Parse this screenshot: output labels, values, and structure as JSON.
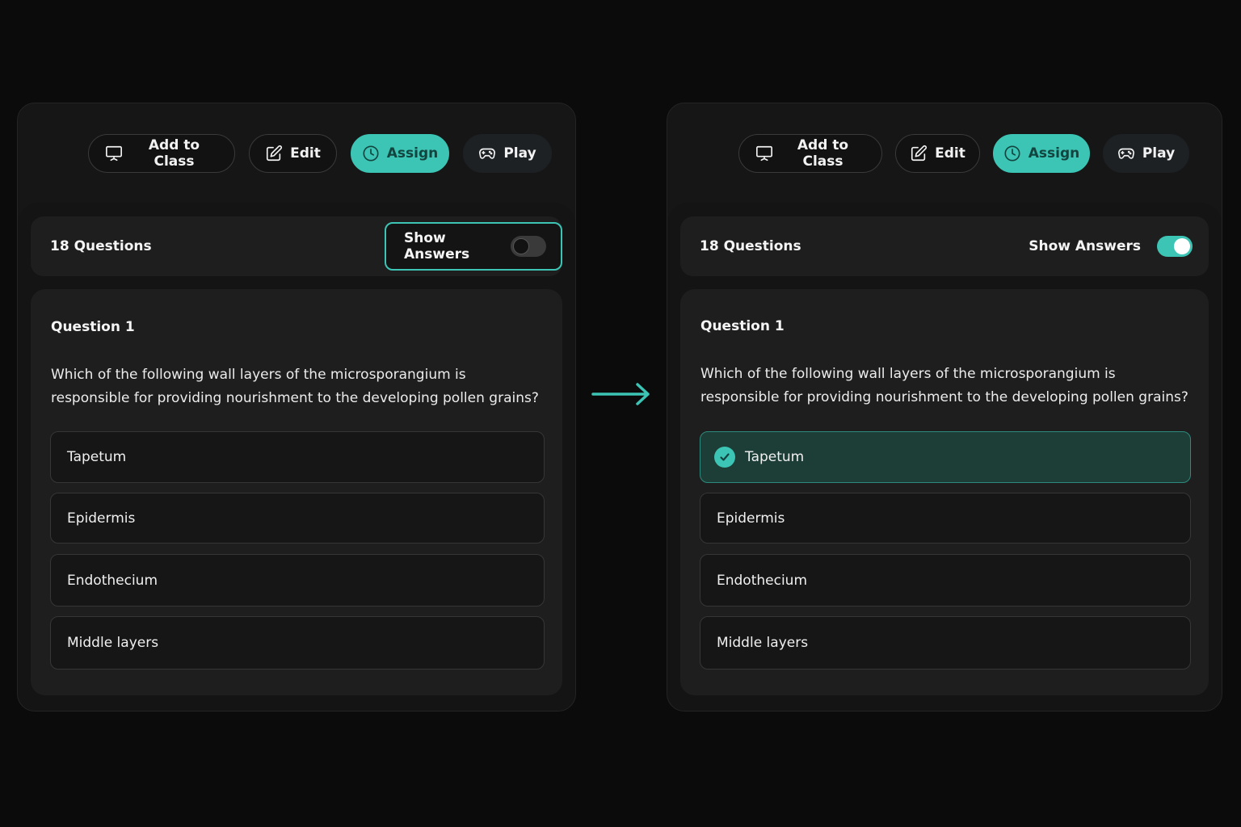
{
  "accent_color": "#3cc4b4",
  "toolbar": {
    "add_to_class": "Add to Class",
    "edit": "Edit",
    "assign": "Assign",
    "play": "Play"
  },
  "icons": {
    "add_to_class": "presentation-board-icon",
    "edit": "pencil-square-icon",
    "assign": "clock-icon",
    "play": "gamepad-icon",
    "correct": "checkmark-circle-icon",
    "transition": "arrow-right-icon"
  },
  "questions_count": "18 Questions",
  "show_answers_label": "Show Answers",
  "before": {
    "show_answers_on": false
  },
  "after": {
    "show_answers_on": true,
    "correct_option_index": 0
  },
  "question": {
    "title": "Question 1",
    "text": "Which of the following wall layers of the microsporangium is responsible for providing nourishment to the developing pollen grains?",
    "options": [
      "Tapetum",
      "Epidermis",
      "Endothecium",
      "Middle layers"
    ]
  }
}
